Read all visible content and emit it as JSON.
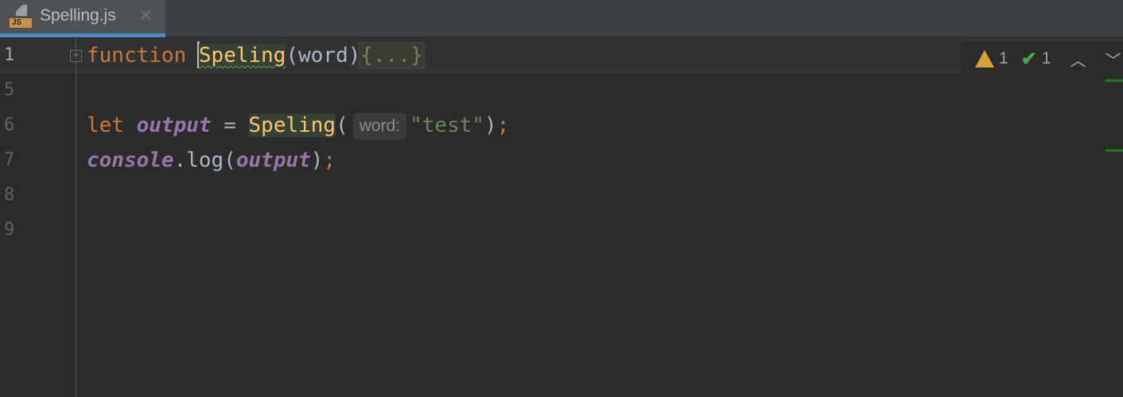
{
  "tab": {
    "title": "Spelling.js",
    "icon_label": "JS"
  },
  "gutter": {
    "line_numbers": [
      "1",
      "5",
      "6",
      "7",
      "8",
      "9"
    ]
  },
  "code": {
    "line1": {
      "keyword": "function ",
      "name": "Speling",
      "params": "(word)",
      "folded": "{...}"
    },
    "line6": {
      "keyword": "let ",
      "var": "output",
      "op": " = ",
      "call": "Speling",
      "open": "(",
      "hint": "word:",
      "arg": "\"test\"",
      "close": ")",
      "semi": ";"
    },
    "line7": {
      "obj": "console",
      "method": ".log(",
      "var": "output",
      "close": ")",
      "semi": ";"
    }
  },
  "inspections": {
    "warnings": "1",
    "typos": "1"
  },
  "colors": {
    "keyword": "#cc7832",
    "function": "#ffc66d",
    "variable": "#9876aa",
    "string": "#6a8759",
    "accent": "#4a88c7"
  }
}
